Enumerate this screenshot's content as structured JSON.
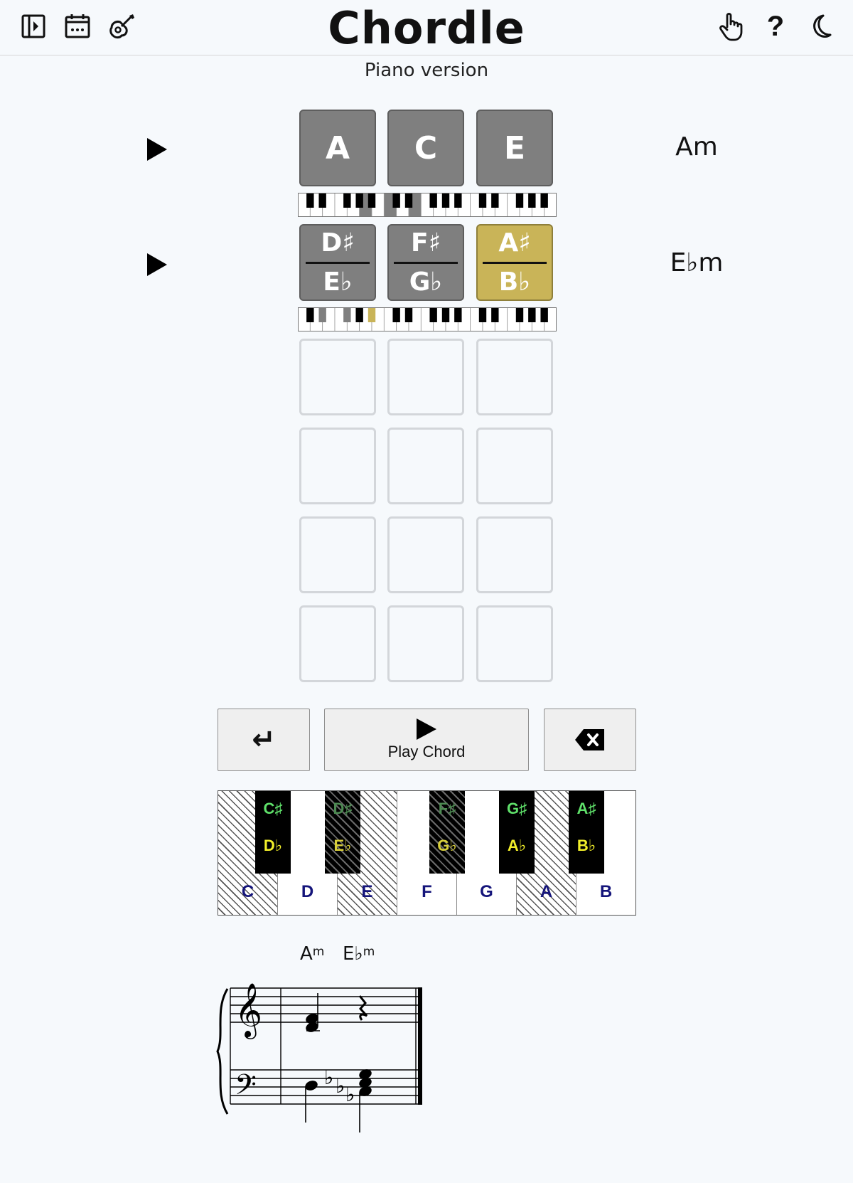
{
  "header": {
    "title": "Chordle",
    "subtitle": "Piano version",
    "left_icons": [
      "sidebar-toggle-icon",
      "calendar-icon",
      "guitar-icon"
    ],
    "right_icons": [
      "hand-pointer-icon",
      "help-icon",
      "moon-icon"
    ],
    "help_glyph": "?"
  },
  "board": {
    "guesses": [
      {
        "chord_root": "A",
        "chord_quality": "m",
        "tiles": [
          {
            "top": "A",
            "bottom": "",
            "state": "absent"
          },
          {
            "top": "C",
            "bottom": "",
            "state": "absent"
          },
          {
            "top": "E",
            "bottom": "",
            "state": "absent"
          }
        ]
      },
      {
        "chord_root": "E♭",
        "chord_quality": "m",
        "tiles": [
          {
            "top": "D♯",
            "bottom": "E♭",
            "state": "absent"
          },
          {
            "top": "F♯",
            "bottom": "G♭",
            "state": "absent"
          },
          {
            "top": "A♯",
            "bottom": "B♭",
            "state": "present"
          }
        ]
      }
    ],
    "empty_rows": 4,
    "colors": {
      "absent": "#7f7f7f",
      "present": "#c9b458",
      "empty_border": "#d3d6da"
    }
  },
  "controls": {
    "enter_glyph": "↵",
    "play_label": "Play Chord",
    "backspace_icon": "backspace-icon"
  },
  "keyboard": {
    "white_keys": [
      {
        "label": "C",
        "hatched": true
      },
      {
        "label": "D",
        "hatched": false
      },
      {
        "label": "E",
        "hatched": true
      },
      {
        "label": "F",
        "hatched": false
      },
      {
        "label": "G",
        "hatched": false
      },
      {
        "label": "A",
        "hatched": true
      },
      {
        "label": "B",
        "hatched": false
      }
    ],
    "black_keys": [
      {
        "sharp": "C♯",
        "flat": "D♭",
        "hatched": false
      },
      {
        "sharp": "D♯",
        "flat": "E♭",
        "hatched": true
      },
      {
        "sharp": "F♯",
        "flat": "G♭",
        "hatched": true
      },
      {
        "sharp": "G♯",
        "flat": "A♭",
        "hatched": false
      },
      {
        "sharp": "A♯",
        "flat": "B♭",
        "hatched": false
      }
    ]
  },
  "score": {
    "chord_labels": [
      {
        "root": "A",
        "quality": "m"
      },
      {
        "root": "E♭",
        "quality": "m"
      }
    ]
  }
}
